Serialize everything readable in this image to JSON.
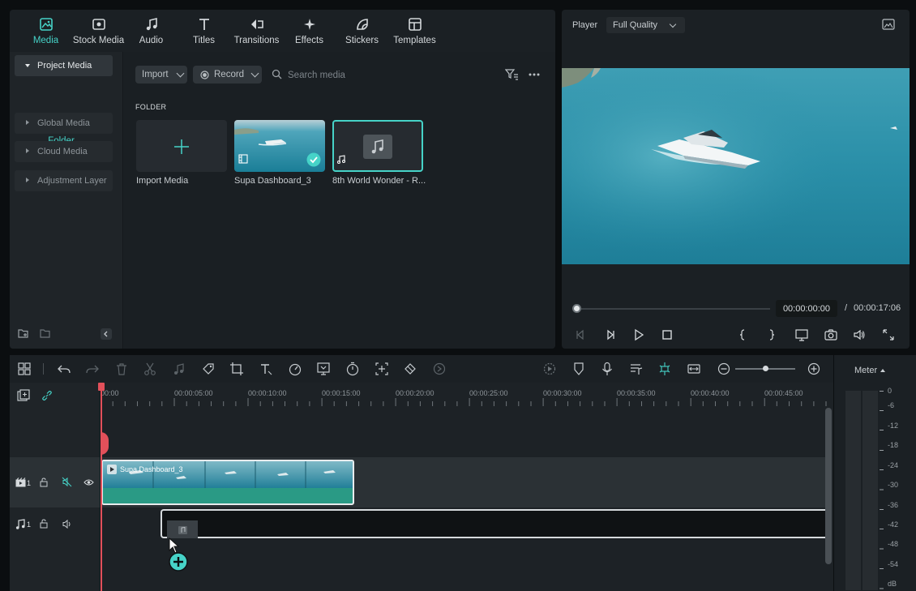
{
  "media_tabs": [
    {
      "label": "Media",
      "icon": "media-icon",
      "active": true
    },
    {
      "label": "Stock Media",
      "icon": "stock-media-icon",
      "active": false
    },
    {
      "label": "Audio",
      "icon": "music-note-icon",
      "active": false
    },
    {
      "label": "Titles",
      "icon": "text-t-icon",
      "active": false
    },
    {
      "label": "Transitions",
      "icon": "transitions-icon",
      "active": false
    },
    {
      "label": "Effects",
      "icon": "sparkle-icon",
      "active": false
    },
    {
      "label": "Stickers",
      "icon": "sticker-icon",
      "active": false
    },
    {
      "label": "Templates",
      "icon": "templates-icon",
      "active": false
    }
  ],
  "sidebar": {
    "project_media": "Project Media",
    "folder": "Folder",
    "items": [
      "Global Media",
      "Cloud Media",
      "Adjustment Layer"
    ]
  },
  "media_toolbar": {
    "import_label": "Import",
    "record_label": "Record",
    "search_placeholder": "Search media"
  },
  "folder_heading": "FOLDER",
  "media_items": [
    {
      "label": "Import Media",
      "type": "import"
    },
    {
      "label": "Supa Dashboard_3",
      "type": "video",
      "selected_check": true
    },
    {
      "label": "8th World Wonder - R...",
      "type": "audio",
      "highlighted": true
    }
  ],
  "player": {
    "label": "Player",
    "quality": "Full Quality",
    "current_time": "00:00:00:00",
    "separator": "/",
    "total_time": "00:00:17:06",
    "progress": 0
  },
  "timeline": {
    "ruler_labels": [
      "00:00",
      "00:00:05:00",
      "00:00:10:00",
      "00:00:15:00",
      "00:00:20:00",
      "00:00:25:00",
      "00:00:30:00",
      "00:00:35:00",
      "00:00:40:00",
      "00:00:45:00"
    ],
    "video_clip_label": "Supa Dashboard_3",
    "video_track_number": "1",
    "audio_track_number": "1"
  },
  "meter": {
    "label": "Meter",
    "db_labels": [
      "0",
      "-6",
      "-12",
      "-18",
      "-24",
      "-30",
      "-36",
      "-42",
      "-48",
      "-54",
      "dB"
    ]
  },
  "colors": {
    "accent": "#46d3c8",
    "clip_green": "#2a9a85",
    "playhead": "#e2505a",
    "panel": "#1b2024"
  }
}
